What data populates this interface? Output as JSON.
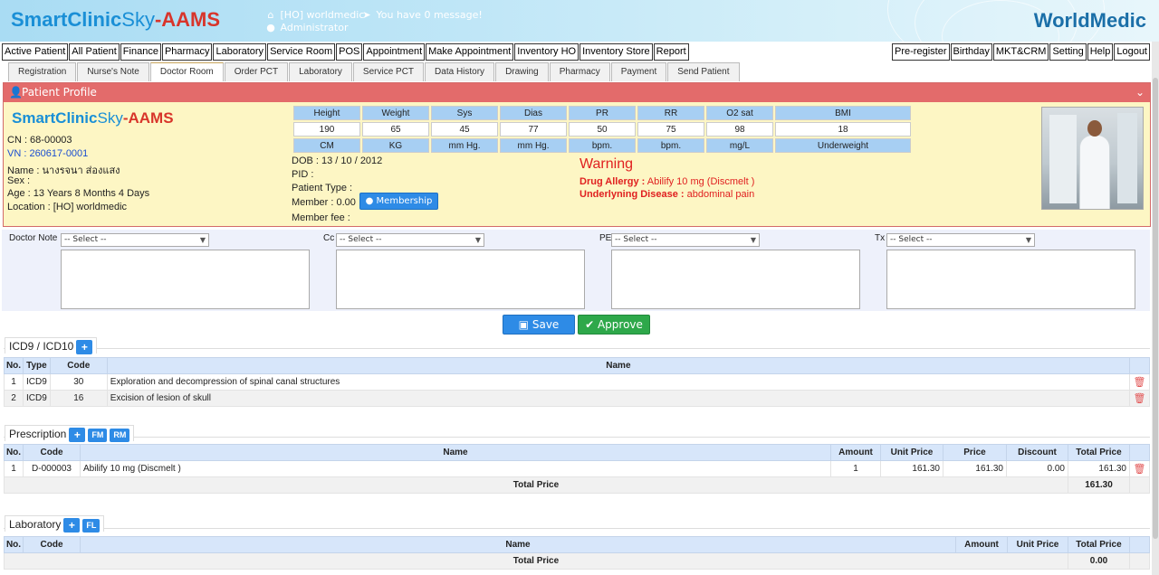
{
  "header": {
    "logo_a": "SmartClinic",
    "logo_b": "Sky",
    "logo_c": "-AAMS",
    "branch": "[HO] worldmedic",
    "user": "Administrator",
    "messages": "You have 0 message!",
    "brand": "WorldMedic",
    "bank_icon": "bank-icon",
    "message_icon": "paper-plane-icon",
    "user_icon": "user-icon"
  },
  "menu_left": [
    "Active Patient",
    "All Patient",
    "Finance",
    "Pharmacy",
    "Laboratory",
    "Service Room",
    "POS",
    "Appointment",
    "Make Appointment",
    "Inventory HO",
    "Inventory Store",
    "Report"
  ],
  "menu_right": [
    "Pre-register",
    "Birthday",
    "MKT&CRM",
    "Setting",
    "Help",
    "Logout"
  ],
  "tabs": [
    "Registration",
    "Nurse's Note",
    "Doctor Room",
    "Order PCT",
    "Laboratory",
    "Service PCT",
    "Data History",
    "Drawing",
    "Pharmacy",
    "Payment",
    "Send Patient"
  ],
  "active_tab": "Doctor Room",
  "profile": {
    "title": "Patient Profile",
    "cn": "CN : 68-00003",
    "vn": "VN : 260617-0001",
    "name": "Name : นางรจนา ส่องแสง",
    "sex": "Sex :",
    "age": "Age : 13 Years 8 Months 4 Days",
    "location": "Location : [HO] worldmedic",
    "dob": "DOB : 13 / 10 / 2012",
    "pid": "PID :",
    "patient_type": "Patient Type :",
    "member": "Member : 0.00",
    "membership_btn": "Membership",
    "member_fee": "Member fee :",
    "warning": "Warning",
    "drug_allergy_label": "Drug Allergy :",
    "drug_allergy": "Abilify 10 mg (Discmelt )",
    "disease_label": "Underlyning Disease :",
    "disease": "abdominal pain"
  },
  "vitals": {
    "headers": [
      "Height",
      "Weight",
      "Sys",
      "Dias",
      "PR",
      "RR",
      "O2 sat",
      "BMI"
    ],
    "values": [
      "190",
      "65",
      "45",
      "77",
      "50",
      "75",
      "98",
      "18"
    ],
    "units": [
      "CM",
      "KG",
      "mm Hg.",
      "mm Hg.",
      "bpm.",
      "bpm.",
      "mg/L",
      "Underweight"
    ]
  },
  "notes": {
    "labels": [
      "Doctor Note",
      "Cc",
      "PE",
      "Tx"
    ],
    "placeholder": "-- Select --"
  },
  "actions": {
    "save": "Save",
    "approve": "Approve"
  },
  "icd": {
    "title": "ICD9 / ICD10",
    "add": "+",
    "columns": [
      "No.",
      "Type",
      "Code",
      "Name"
    ],
    "rows": [
      {
        "no": "1",
        "type": "ICD9",
        "code": "30",
        "name": "Exploration and decompression of spinal canal structures"
      },
      {
        "no": "2",
        "type": "ICD9",
        "code": "16",
        "name": "Excision of lesion of skull"
      }
    ]
  },
  "prescription": {
    "title": "Prescription",
    "add": "+",
    "fm": "FM",
    "rm": "RM",
    "columns": [
      "No.",
      "Code",
      "Name",
      "Amount",
      "Unit Price",
      "Price",
      "Discount",
      "Total Price"
    ],
    "rows": [
      {
        "no": "1",
        "code": "D-000003",
        "name": "Abilify 10 mg (Discmelt )",
        "amount": "1",
        "unit_price": "161.30",
        "price": "161.30",
        "discount": "0.00",
        "total": "161.30"
      }
    ],
    "total_label": "Total Price",
    "total": "161.30"
  },
  "laboratory": {
    "title": "Laboratory",
    "add": "+",
    "fl": "FL",
    "columns": [
      "No.",
      "Code",
      "Name",
      "Amount",
      "Unit Price",
      "Total Price"
    ],
    "total_label": "Total Price",
    "total": "0.00"
  }
}
